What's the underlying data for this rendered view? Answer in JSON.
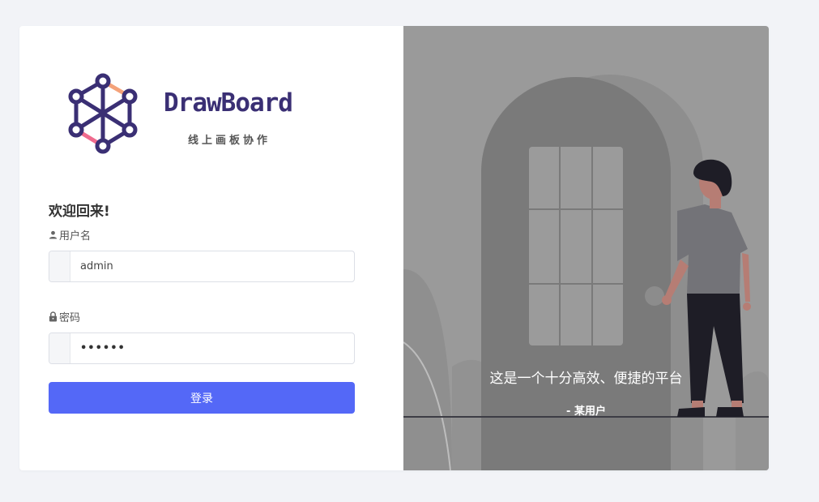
{
  "brand": {
    "name": "DrawBoard",
    "subtitle": "线上画板协作",
    "colors": {
      "primary": "#3a2f74",
      "accent_orange": "#f4a27a",
      "accent_pink": "#f06b8e"
    }
  },
  "login": {
    "welcome": "欢迎回来!",
    "username_label": "用户名",
    "username_value": "admin",
    "password_label": "密码",
    "password_value": "••••••",
    "submit_label": "登录",
    "icons": {
      "username": "user-icon",
      "password": "lock-icon"
    },
    "button_color": "#5468f7"
  },
  "hero": {
    "quote": "这是一个十分高效、便捷的平台",
    "author": "- 某用户",
    "background_color": "#9a9a9a"
  }
}
